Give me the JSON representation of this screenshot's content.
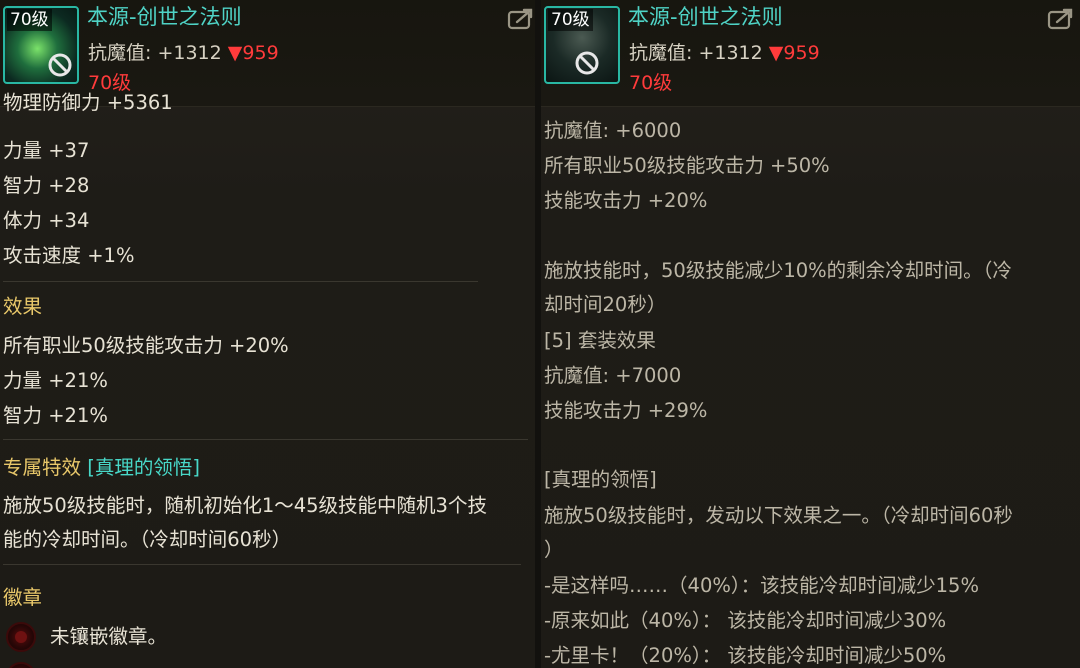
{
  "left": {
    "level_badge": "70级",
    "item_name": "本源-创世之法则",
    "stat_label": "抗魔值: ",
    "stat_up": "+1312",
    "stat_down": "▼959",
    "level_red": "70级",
    "cut_line": "物理防御力 +5361",
    "stats": [
      "力量 +37",
      "智力 +28",
      "体力 +34",
      "攻击速度 +1%"
    ],
    "effect_title": "效果",
    "effects": [
      "所有职业50级技能攻击力 +20%",
      "力量 +21%",
      "智力 +21%"
    ],
    "special_title": "专属特效",
    "special_name": "[真理的领悟]",
    "special_desc": [
      "施放50级技能时，随机初始化1～45级技能中随机3个技",
      "能的冷却时间。（冷却时间60秒）"
    ],
    "emblem_title": "徽章",
    "emblem_text": "未镶嵌徽章。"
  },
  "right": {
    "level_badge": "70级",
    "item_name": "本源-创世之法则",
    "stat_label": "抗魔值: ",
    "stat_up": "+1312",
    "stat_down": "▼959",
    "level_red": "70级",
    "lines": [
      "抗魔值: +6000",
      "所有职业50级技能攻击力 +50%",
      "技能攻击力 +20%",
      "",
      "施放技能时，50级技能减少10%的剩余冷却时间。（冷",
      "却时间20秒）",
      "[5] 套装效果",
      "抗魔值: +7000",
      "技能攻击力 +29%",
      "",
      "[真理的领悟]",
      "施放50级技能时，发动以下效果之一。（冷却时间60秒",
      "）",
      "-是这样吗……（40%）：该技能冷却时间减少15%",
      "-原来如此（40%）：  该技能冷却时间减少30%",
      "-尤里卡！（20%）：  该技能冷却时间减少50%"
    ]
  },
  "colors": {
    "item_name": "#4fd3c6",
    "down": "#ff3b3b",
    "section_title": "#e9c86a",
    "special_name": "#48d8c8",
    "text": "#e7e2d4",
    "icon_border": "#29b7a3"
  },
  "icons": {
    "export": "export-arrow-icon",
    "disabled": "no-entry-icon",
    "emblem_slot": "emblem-slot-icon"
  }
}
